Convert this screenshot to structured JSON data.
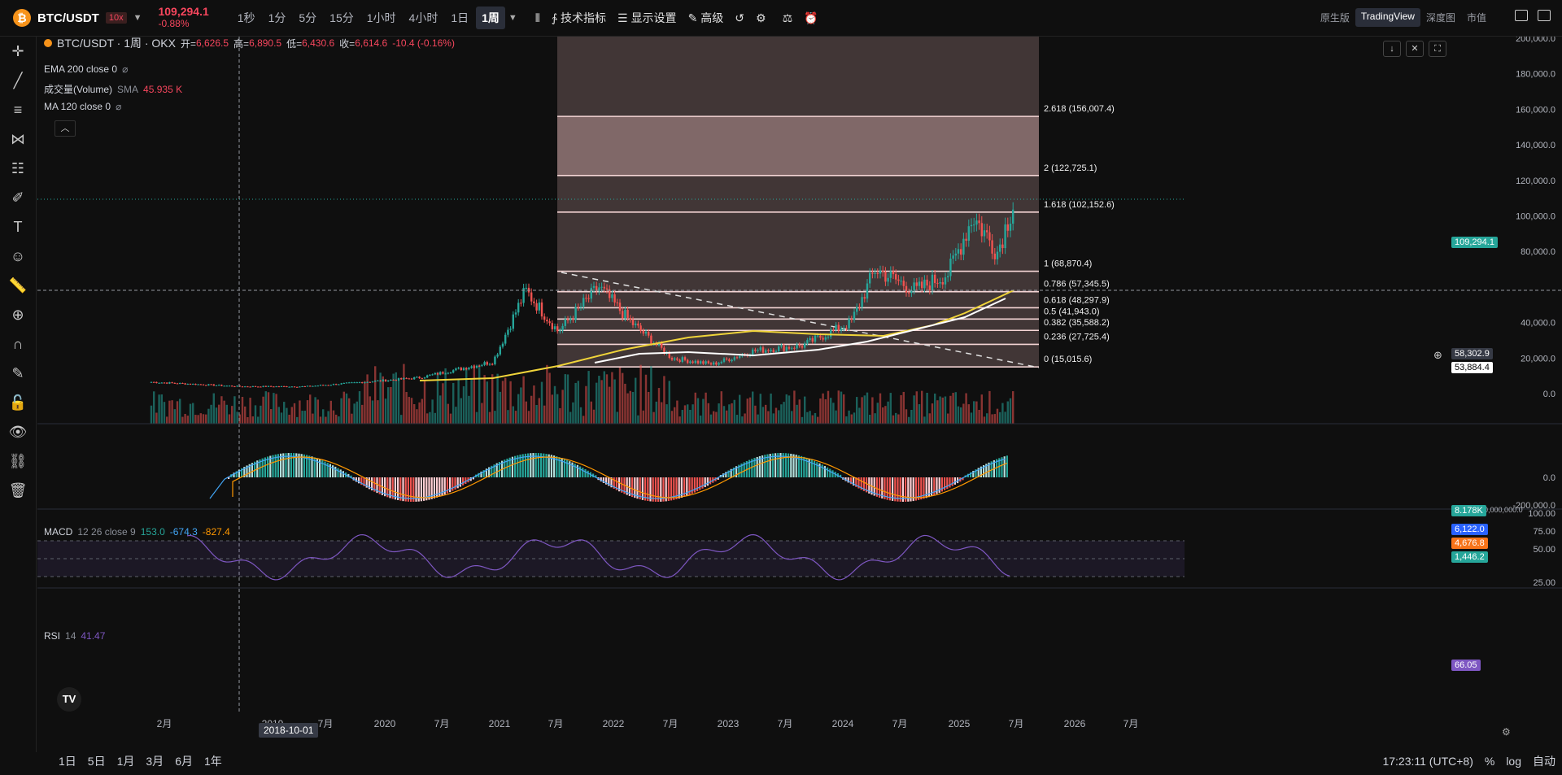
{
  "header": {
    "symbol": "BTC/USDT",
    "leverage": "10x",
    "price": "109,294.1",
    "change": "-0.88%",
    "timeframes": [
      "1秒",
      "1分",
      "5分",
      "15分",
      "1小时",
      "4小时",
      "1日",
      "1周"
    ],
    "active_timeframe": "1周",
    "tools": [
      "技术指标",
      "显示设置",
      "高级"
    ],
    "view_tabs": [
      "原生版",
      "TradingView",
      "深度图",
      "市值"
    ],
    "active_view": "TradingView"
  },
  "legend": {
    "title": "BTC/USDT · 1周 · OKX",
    "open_label": "开=",
    "open": "6,626.5",
    "high_label": "高=",
    "high": "6,890.5",
    "low_label": "低=",
    "low": "6,430.6",
    "close_label": "收=",
    "close": "6,614.6",
    "change": "-10.4 (-0.16%)",
    "ema": "EMA 200 close 0",
    "volume_name": "成交量(Volume)",
    "volume_sma": "SMA",
    "volume_val": "45.935 K",
    "ma": "MA 120 close 0",
    "macd_name": "MACD",
    "macd_params": "12 26 close 9",
    "macd_v1": "153.0",
    "macd_v2": "-674.3",
    "macd_v3": "-827.4",
    "rsi_name": "RSI",
    "rsi_param": "14",
    "rsi_val": "41.47"
  },
  "price_axis": [
    "200,000.0",
    "180,000.0",
    "160,000.0",
    "140,000.0",
    "120,000.0",
    "100,000.0",
    "80,000.0",
    "40,000.0",
    "20,000.0",
    "0.0"
  ],
  "fib_levels": [
    {
      "label": "2.618 (156,007.4)"
    },
    {
      "label": "2 (122,725.1)"
    },
    {
      "label": "1.618 (102,152.6)"
    },
    {
      "label": "1 (68,870.4)"
    },
    {
      "label": "0.786 (57,345.5)"
    },
    {
      "label": "0.618 (48,297.9)"
    },
    {
      "label": "0.5 (41,943.0)"
    },
    {
      "label": "0.382 (35,588.2)"
    },
    {
      "label": "0.236 (27,725.4)"
    },
    {
      "label": "0 (15,015.6)"
    }
  ],
  "tags": {
    "last_price": "109,294.1",
    "crosshair_price": "58,302.9",
    "ma_price": "53,884.4",
    "volume": "8.178K",
    "macd_a": "6,122.0",
    "macd_b": "4,676.8",
    "macd_c": "1,446.2",
    "rsi": "66.05",
    "crosshair_date": "2018-10-01",
    "vol_axis": "40,000,000,000,000.0"
  },
  "macd_axis": [
    "0.0",
    "-200,000.0"
  ],
  "rsi_axis": [
    "100.00",
    "75.00",
    "50.00",
    "25.00"
  ],
  "x_axis": [
    "2月",
    "2019",
    "7月",
    "2020",
    "7月",
    "2021",
    "7月",
    "2022",
    "7月",
    "2023",
    "7月",
    "2024",
    "7月",
    "2025",
    "7月",
    "2026",
    "7月"
  ],
  "bottom": {
    "ranges": [
      "1日",
      "5日",
      "1月",
      "3月",
      "6月",
      "1年"
    ],
    "time": "17:23:11 (UTC+8)",
    "pct": "%",
    "log": "log",
    "auto": "自动"
  },
  "colors": {
    "up": "#26a69a",
    "down": "#ef5350",
    "ema": "#f0d43a",
    "ma": "#ffffff",
    "rsi": "#7e57c2",
    "fib_fill": "#f5c6c6"
  }
}
